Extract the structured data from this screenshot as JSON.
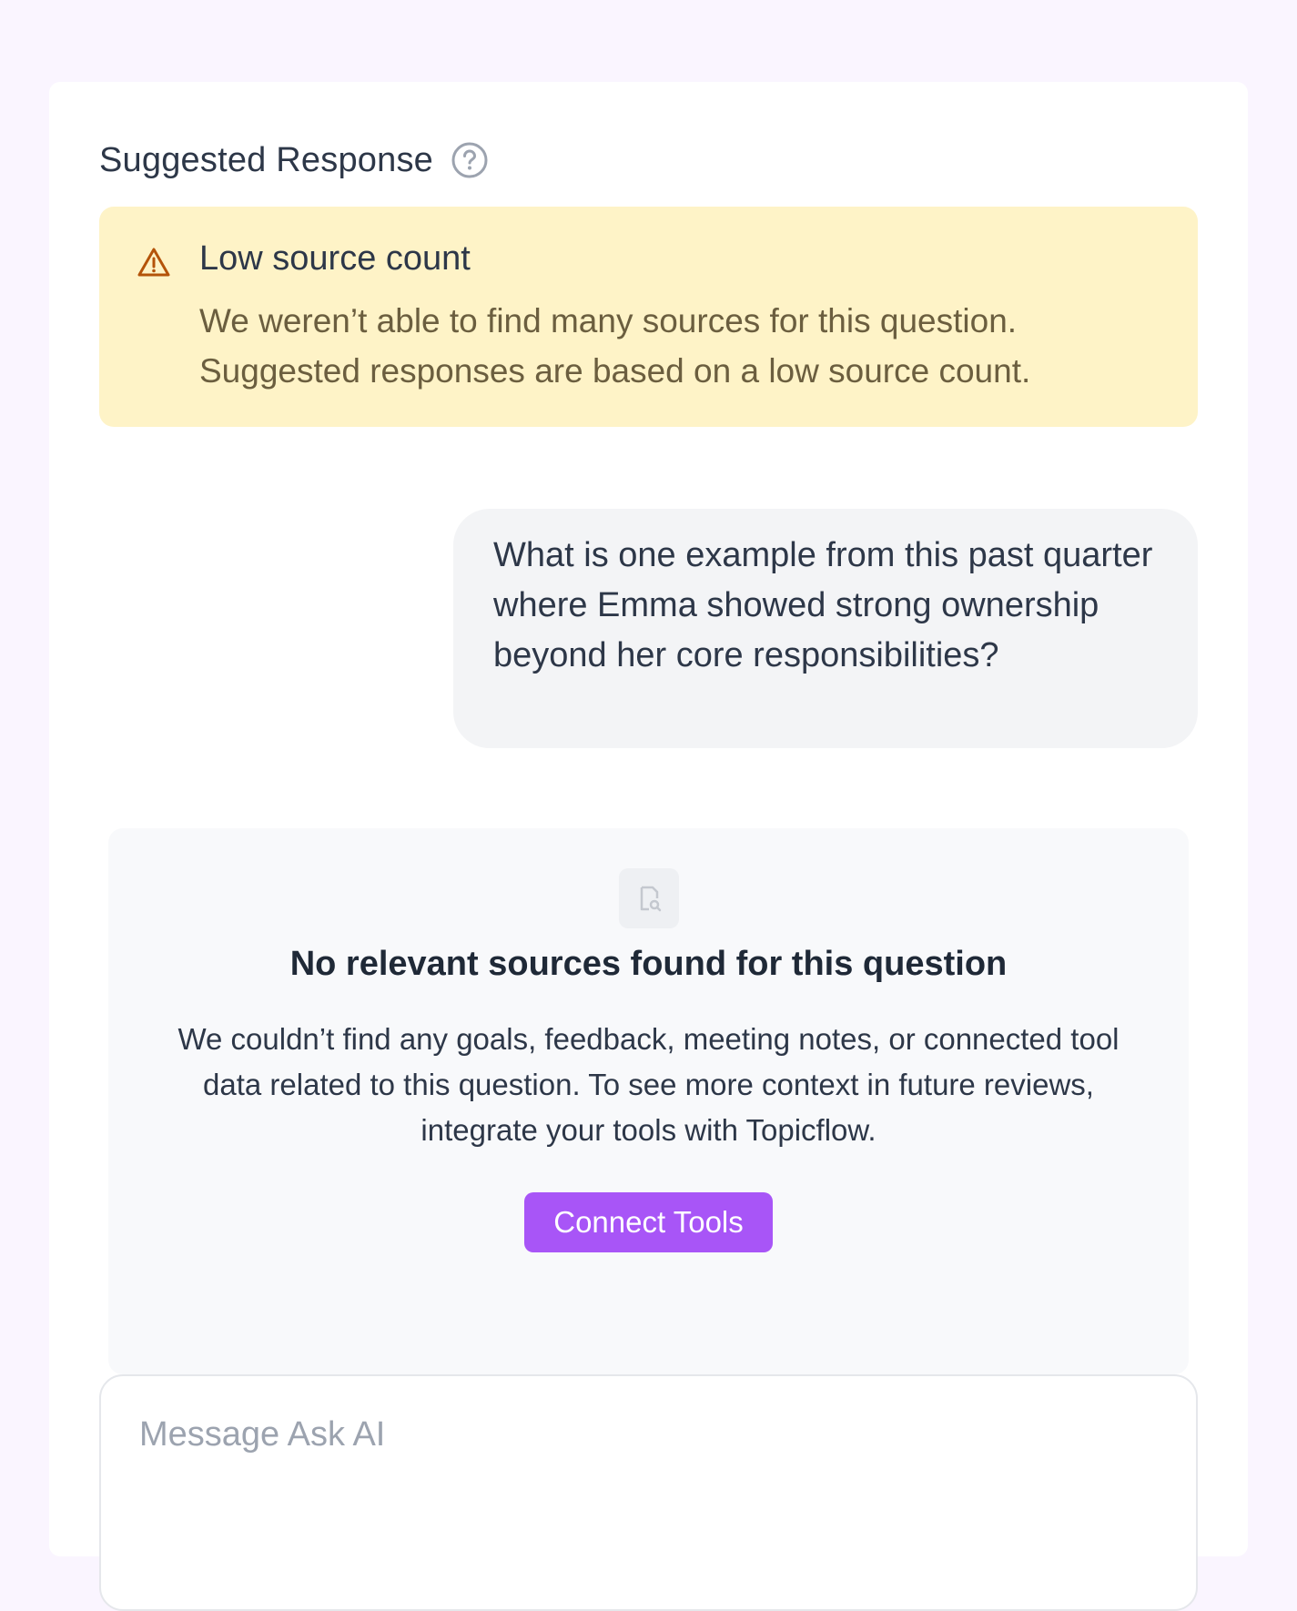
{
  "header": {
    "title": "Suggested Response",
    "help_icon": "question-circle-icon"
  },
  "alert": {
    "icon": "warning-triangle-icon",
    "title": "Low source count",
    "line1": "We weren’t able to find many sources for this question.",
    "line2": "Suggested responses are based on a low source count.",
    "colors": {
      "background": "#fef3c7",
      "icon": "#b45309"
    }
  },
  "user_message": {
    "text": "What is one example from this past quarter where Emma showed strong ownership beyond her core responsibilities?"
  },
  "empty_state": {
    "icon": "document-search-icon",
    "title": "No relevant sources found for this question",
    "body": "We couldn’t find any goals, feedback, meeting notes, or connected tool data related to this question. To see more context in future reviews, integrate your tools with Topicflow.",
    "button_label": "Connect Tools",
    "colors": {
      "button": "#a855f7"
    }
  },
  "composer": {
    "placeholder": "Message Ask AI",
    "value": ""
  }
}
